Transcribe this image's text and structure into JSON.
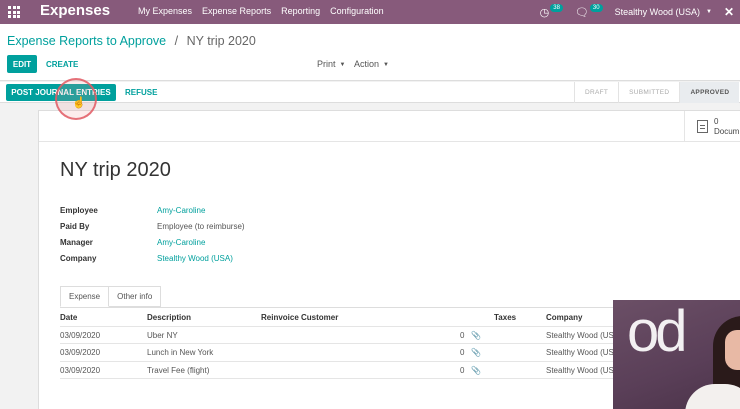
{
  "navbar": {
    "app_title": "Expenses",
    "menu": [
      "My Expenses",
      "Expense Reports",
      "Reporting",
      "Configuration"
    ],
    "activity_count": "38",
    "message_count": "30",
    "company": "Stealthy Wood (USA)"
  },
  "breadcrumb": {
    "parent": "Expense Reports to Approve",
    "separator": "/",
    "current": "NY trip 2020"
  },
  "toolbar": {
    "edit_label": "EDIT",
    "create_label": "CREATE",
    "print_label": "Print",
    "action_label": "Action"
  },
  "statusbar": {
    "post_label": "POST JOURNAL ENTRIES",
    "refuse_label": "REFUSE",
    "stages": [
      "DRAFT",
      "SUBMITTED",
      "APPROVED"
    ],
    "active_stage": "APPROVED"
  },
  "smart_button": {
    "count": "0",
    "label": "Docum"
  },
  "record": {
    "title": "NY trip 2020",
    "fields": [
      {
        "label": "Employee",
        "value": "Amy-Caroline",
        "link": true
      },
      {
        "label": "Paid By",
        "value": "Employee (to reimburse)",
        "link": false
      },
      {
        "label": "Manager",
        "value": "Amy-Caroline",
        "link": true
      },
      {
        "label": "Company",
        "value": "Stealthy Wood (USA)",
        "link": true
      }
    ]
  },
  "tabs": [
    "Expense",
    "Other info"
  ],
  "table": {
    "headers": {
      "date": "Date",
      "description": "Description",
      "reinvoice": "Reinvoice Customer",
      "taxes": "Taxes",
      "company": "Company"
    },
    "rows": [
      {
        "date": "03/09/2020",
        "description": "Uber NY",
        "qty": "0",
        "company": "Stealthy Wood (US"
      },
      {
        "date": "03/09/2020",
        "description": "Lunch in New York",
        "qty": "0",
        "company": "Stealthy Wood (US"
      },
      {
        "date": "03/09/2020",
        "description": "Travel Fee (flight)",
        "qty": "0",
        "company": "Stealthy Wood (US"
      }
    ]
  },
  "colors": {
    "navbar": "#875a7b",
    "primary": "#00a09d"
  },
  "icons": {
    "apps": "apps-grid-icon",
    "activity": "clock-icon",
    "messages": "chat-icon",
    "debug": "bug-icon",
    "attachment": "paperclip-icon",
    "document": "document-icon"
  }
}
